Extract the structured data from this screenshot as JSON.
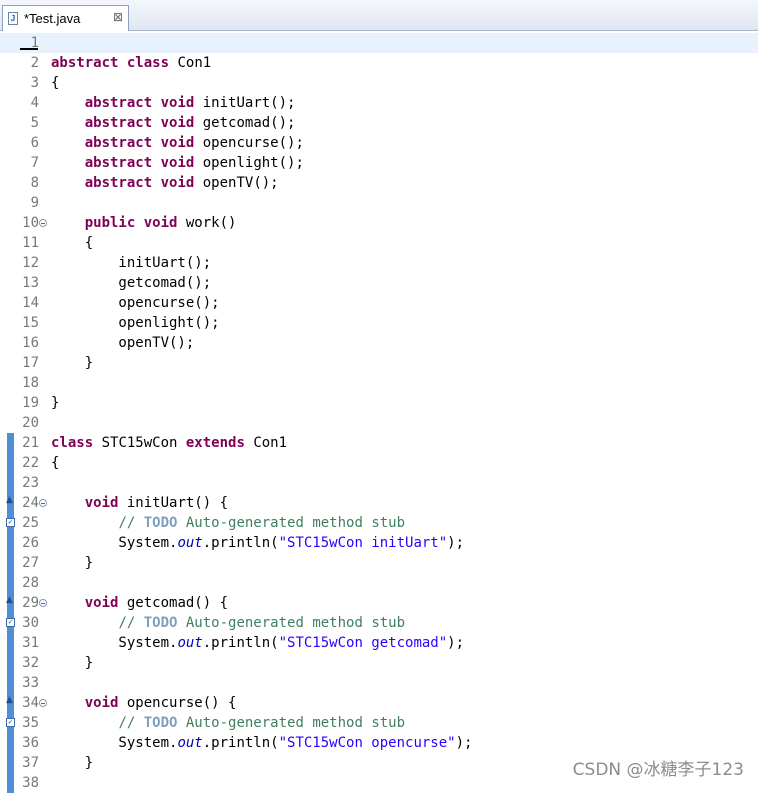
{
  "tab": {
    "title": "*Test.java",
    "icon": "java-file-icon",
    "close_glyph": "⊠"
  },
  "watermark": "CSDN @冰糖李子123",
  "colors": {
    "keyword": "#7f0055",
    "comment": "#3f7f5f",
    "todo": "#7f9fbf",
    "string": "#2a00ff",
    "field": "#0000c0",
    "current_line": "#e8f2fe",
    "marker_bar": "#4f8fd7"
  },
  "lines": [
    {
      "n": "1",
      "current": true,
      "tokens": []
    },
    {
      "n": "2",
      "tokens": [
        {
          "t": "kw",
          "v": "abstract"
        },
        {
          "t": "n",
          "v": " "
        },
        {
          "t": "kw",
          "v": "class"
        },
        {
          "t": "n",
          "v": " Con1"
        }
      ]
    },
    {
      "n": "3",
      "tokens": [
        {
          "t": "n",
          "v": "{"
        }
      ]
    },
    {
      "n": "4",
      "tokens": [
        {
          "t": "n",
          "v": "    "
        },
        {
          "t": "kw",
          "v": "abstract"
        },
        {
          "t": "n",
          "v": " "
        },
        {
          "t": "kw",
          "v": "void"
        },
        {
          "t": "n",
          "v": " initUart();"
        }
      ]
    },
    {
      "n": "5",
      "tokens": [
        {
          "t": "n",
          "v": "    "
        },
        {
          "t": "kw",
          "v": "abstract"
        },
        {
          "t": "n",
          "v": " "
        },
        {
          "t": "kw",
          "v": "void"
        },
        {
          "t": "n",
          "v": " getcomad();"
        }
      ]
    },
    {
      "n": "6",
      "tokens": [
        {
          "t": "n",
          "v": "    "
        },
        {
          "t": "kw",
          "v": "abstract"
        },
        {
          "t": "n",
          "v": " "
        },
        {
          "t": "kw",
          "v": "void"
        },
        {
          "t": "n",
          "v": " opencurse();"
        }
      ]
    },
    {
      "n": "7",
      "tokens": [
        {
          "t": "n",
          "v": "    "
        },
        {
          "t": "kw",
          "v": "abstract"
        },
        {
          "t": "n",
          "v": " "
        },
        {
          "t": "kw",
          "v": "void"
        },
        {
          "t": "n",
          "v": " openlight();"
        }
      ]
    },
    {
      "n": "8",
      "tokens": [
        {
          "t": "n",
          "v": "    "
        },
        {
          "t": "kw",
          "v": "abstract"
        },
        {
          "t": "n",
          "v": " "
        },
        {
          "t": "kw",
          "v": "void"
        },
        {
          "t": "n",
          "v": " openTV();"
        }
      ]
    },
    {
      "n": "9",
      "tokens": []
    },
    {
      "n": "10",
      "fold": true,
      "tokens": [
        {
          "t": "n",
          "v": "    "
        },
        {
          "t": "kw",
          "v": "public"
        },
        {
          "t": "n",
          "v": " "
        },
        {
          "t": "kw",
          "v": "void"
        },
        {
          "t": "n",
          "v": " work()"
        }
      ]
    },
    {
      "n": "11",
      "tokens": [
        {
          "t": "n",
          "v": "    {"
        }
      ]
    },
    {
      "n": "12",
      "tokens": [
        {
          "t": "n",
          "v": "        initUart();"
        }
      ]
    },
    {
      "n": "13",
      "tokens": [
        {
          "t": "n",
          "v": "        getcomad();"
        }
      ]
    },
    {
      "n": "14",
      "tokens": [
        {
          "t": "n",
          "v": "        opencurse();"
        }
      ]
    },
    {
      "n": "15",
      "tokens": [
        {
          "t": "n",
          "v": "        openlight();"
        }
      ]
    },
    {
      "n": "16",
      "tokens": [
        {
          "t": "n",
          "v": "        openTV();"
        }
      ]
    },
    {
      "n": "17",
      "tokens": [
        {
          "t": "n",
          "v": "    }"
        }
      ]
    },
    {
      "n": "18",
      "tokens": []
    },
    {
      "n": "19",
      "tokens": [
        {
          "t": "n",
          "v": "}"
        }
      ]
    },
    {
      "n": "20",
      "tokens": []
    },
    {
      "n": "21",
      "bar": true,
      "tokens": [
        {
          "t": "kw",
          "v": "class"
        },
        {
          "t": "n",
          "v": " STC15wCon "
        },
        {
          "t": "kw",
          "v": "extends"
        },
        {
          "t": "n",
          "v": " Con1"
        }
      ]
    },
    {
      "n": "22",
      "bar": true,
      "tokens": [
        {
          "t": "n",
          "v": "{"
        }
      ]
    },
    {
      "n": "23",
      "bar": true,
      "tokens": []
    },
    {
      "n": "24",
      "bar": true,
      "marker": "override",
      "fold": true,
      "tokens": [
        {
          "t": "n",
          "v": "    "
        },
        {
          "t": "kw",
          "v": "void"
        },
        {
          "t": "n",
          "v": " initUart() {"
        }
      ]
    },
    {
      "n": "25",
      "bar": true,
      "marker": "task",
      "tokens": [
        {
          "t": "n",
          "v": "        "
        },
        {
          "t": "cm",
          "v": "// "
        },
        {
          "t": "todo",
          "v": "TODO"
        },
        {
          "t": "cm",
          "v": " Auto-generated method stub"
        }
      ]
    },
    {
      "n": "26",
      "bar": true,
      "tokens": [
        {
          "t": "n",
          "v": "        System."
        },
        {
          "t": "fi",
          "v": "out"
        },
        {
          "t": "n",
          "v": ".println("
        },
        {
          "t": "st",
          "v": "\"STC15wCon initUart\""
        },
        {
          "t": "n",
          "v": ");"
        }
      ]
    },
    {
      "n": "27",
      "bar": true,
      "tokens": [
        {
          "t": "n",
          "v": "    }"
        }
      ]
    },
    {
      "n": "28",
      "bar": true,
      "tokens": []
    },
    {
      "n": "29",
      "bar": true,
      "marker": "override",
      "fold": true,
      "tokens": [
        {
          "t": "n",
          "v": "    "
        },
        {
          "t": "kw",
          "v": "void"
        },
        {
          "t": "n",
          "v": " getcomad() {"
        }
      ]
    },
    {
      "n": "30",
      "bar": true,
      "marker": "task",
      "tokens": [
        {
          "t": "n",
          "v": "        "
        },
        {
          "t": "cm",
          "v": "// "
        },
        {
          "t": "todo",
          "v": "TODO"
        },
        {
          "t": "cm",
          "v": " Auto-generated method stub"
        }
      ]
    },
    {
      "n": "31",
      "bar": true,
      "tokens": [
        {
          "t": "n",
          "v": "        System."
        },
        {
          "t": "fi",
          "v": "out"
        },
        {
          "t": "n",
          "v": ".println("
        },
        {
          "t": "st",
          "v": "\"STC15wCon getcomad\""
        },
        {
          "t": "n",
          "v": ");"
        }
      ]
    },
    {
      "n": "32",
      "bar": true,
      "tokens": [
        {
          "t": "n",
          "v": "    }"
        }
      ]
    },
    {
      "n": "33",
      "bar": true,
      "tokens": []
    },
    {
      "n": "34",
      "bar": true,
      "marker": "override",
      "fold": true,
      "tokens": [
        {
          "t": "n",
          "v": "    "
        },
        {
          "t": "kw",
          "v": "void"
        },
        {
          "t": "n",
          "v": " opencurse() {"
        }
      ]
    },
    {
      "n": "35",
      "bar": true,
      "marker": "task",
      "tokens": [
        {
          "t": "n",
          "v": "        "
        },
        {
          "t": "cm",
          "v": "// "
        },
        {
          "t": "todo",
          "v": "TODO"
        },
        {
          "t": "cm",
          "v": " Auto-generated method stub"
        }
      ]
    },
    {
      "n": "36",
      "bar": true,
      "tokens": [
        {
          "t": "n",
          "v": "        System."
        },
        {
          "t": "fi",
          "v": "out"
        },
        {
          "t": "n",
          "v": ".println("
        },
        {
          "t": "st",
          "v": "\"STC15wCon opencurse\""
        },
        {
          "t": "n",
          "v": ");"
        }
      ]
    },
    {
      "n": "37",
      "bar": true,
      "tokens": [
        {
          "t": "n",
          "v": "    }"
        }
      ]
    },
    {
      "n": "38",
      "bar": true,
      "tokens": []
    }
  ]
}
